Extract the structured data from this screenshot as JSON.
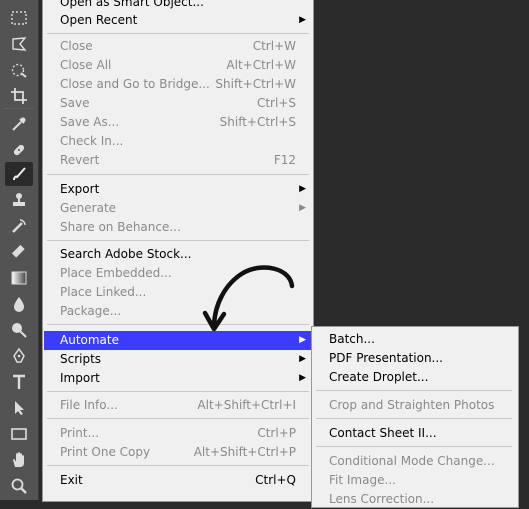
{
  "tools": [
    {
      "name": "marquee-tool-icon"
    },
    {
      "name": "lasso-tool-icon"
    },
    {
      "name": "quick-selection-tool-icon"
    },
    {
      "name": "crop-tool-icon"
    },
    {
      "name": "eyedropper-tool-icon"
    },
    {
      "name": "healing-brush-tool-icon"
    },
    {
      "name": "brush-tool-icon"
    },
    {
      "name": "clone-stamp-tool-icon"
    },
    {
      "name": "history-brush-tool-icon"
    },
    {
      "name": "eraser-tool-icon"
    },
    {
      "name": "gradient-tool-icon"
    },
    {
      "name": "blur-tool-icon"
    },
    {
      "name": "dodge-tool-icon"
    },
    {
      "name": "pen-tool-icon"
    },
    {
      "name": "type-tool-icon"
    },
    {
      "name": "path-selection-tool-icon"
    },
    {
      "name": "rectangle-tool-icon"
    },
    {
      "name": "hand-tool-icon"
    },
    {
      "name": "zoom-tool-icon"
    }
  ],
  "file_menu": {
    "items": [
      {
        "label": "Open as Smart Object...",
        "shortcut": "",
        "disabled": false,
        "submenu": false
      },
      {
        "label": "Open Recent",
        "shortcut": "",
        "disabled": false,
        "submenu": true
      },
      {
        "label": "Close",
        "shortcut": "Ctrl+W",
        "disabled": true,
        "submenu": false
      },
      {
        "label": "Close All",
        "shortcut": "Alt+Ctrl+W",
        "disabled": true,
        "submenu": false
      },
      {
        "label": "Close and Go to Bridge...",
        "shortcut": "Shift+Ctrl+W",
        "disabled": true,
        "submenu": false
      },
      {
        "label": "Save",
        "shortcut": "Ctrl+S",
        "disabled": true,
        "submenu": false
      },
      {
        "label": "Save As...",
        "shortcut": "Shift+Ctrl+S",
        "disabled": true,
        "submenu": false
      },
      {
        "label": "Check In...",
        "shortcut": "",
        "disabled": true,
        "submenu": false
      },
      {
        "label": "Revert",
        "shortcut": "F12",
        "disabled": true,
        "submenu": false
      },
      {
        "label": "Export",
        "shortcut": "",
        "disabled": false,
        "submenu": true
      },
      {
        "label": "Generate",
        "shortcut": "",
        "disabled": true,
        "submenu": true
      },
      {
        "label": "Share on Behance...",
        "shortcut": "",
        "disabled": true,
        "submenu": false
      },
      {
        "label": "Search Adobe Stock...",
        "shortcut": "",
        "disabled": false,
        "submenu": false
      },
      {
        "label": "Place Embedded...",
        "shortcut": "",
        "disabled": true,
        "submenu": false
      },
      {
        "label": "Place Linked...",
        "shortcut": "",
        "disabled": true,
        "submenu": false
      },
      {
        "label": "Package...",
        "shortcut": "",
        "disabled": true,
        "submenu": false
      },
      {
        "label": "Automate",
        "shortcut": "",
        "disabled": false,
        "submenu": true,
        "highlight": true
      },
      {
        "label": "Scripts",
        "shortcut": "",
        "disabled": false,
        "submenu": true
      },
      {
        "label": "Import",
        "shortcut": "",
        "disabled": false,
        "submenu": true
      },
      {
        "label": "File Info...",
        "shortcut": "Alt+Shift+Ctrl+I",
        "disabled": true,
        "submenu": false
      },
      {
        "label": "Print...",
        "shortcut": "Ctrl+P",
        "disabled": true,
        "submenu": false
      },
      {
        "label": "Print One Copy",
        "shortcut": "Alt+Shift+Ctrl+P",
        "disabled": true,
        "submenu": false
      },
      {
        "label": "Exit",
        "shortcut": "Ctrl+Q",
        "disabled": false,
        "submenu": false
      }
    ]
  },
  "automate_submenu": {
    "items": [
      {
        "label": "Batch...",
        "disabled": false
      },
      {
        "label": "PDF Presentation...",
        "disabled": false
      },
      {
        "label": "Create Droplet...",
        "disabled": false
      },
      {
        "label": "Crop and Straighten Photos",
        "disabled": true
      },
      {
        "label": "Contact Sheet II...",
        "disabled": false
      },
      {
        "label": "Conditional Mode Change...",
        "disabled": true
      },
      {
        "label": "Fit Image...",
        "disabled": true
      },
      {
        "label": "Lens Correction...",
        "disabled": true
      }
    ]
  },
  "colors": {
    "highlight": "#3c3cff",
    "menu_bg": "#f0f0f0",
    "disabled_text": "#8a8a8a",
    "toolbar_bg": "#535353",
    "workspace_bg": "#2b2b2b"
  }
}
